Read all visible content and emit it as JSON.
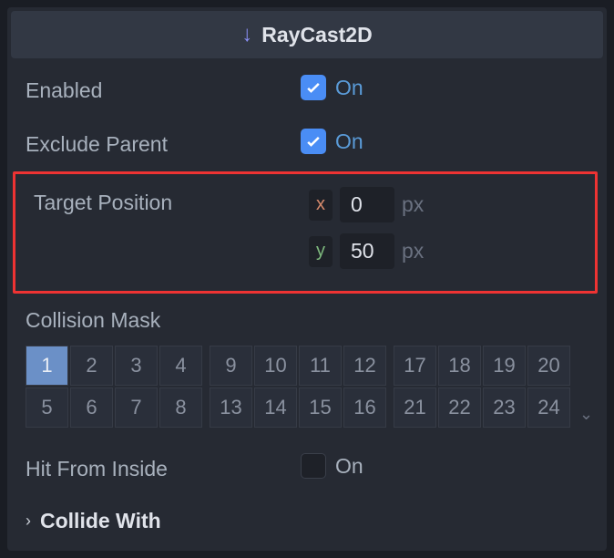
{
  "header": {
    "title": "RayCast2D"
  },
  "props": {
    "enabled": {
      "label": "Enabled",
      "state": "On"
    },
    "exclude_parent": {
      "label": "Exclude Parent",
      "state": "On"
    },
    "target_position": {
      "label": "Target Position",
      "x_label": "x",
      "x_value": "0",
      "y_label": "y",
      "y_value": "50",
      "unit": "px"
    },
    "collision_mask": {
      "label": "Collision Mask",
      "groups": [
        [
          {
            "n": "1",
            "active": true
          },
          {
            "n": "2",
            "active": false
          },
          {
            "n": "3",
            "active": false
          },
          {
            "n": "4",
            "active": false
          },
          {
            "n": "5",
            "active": false
          },
          {
            "n": "6",
            "active": false
          },
          {
            "n": "7",
            "active": false
          },
          {
            "n": "8",
            "active": false
          }
        ],
        [
          {
            "n": "9",
            "active": false
          },
          {
            "n": "10",
            "active": false
          },
          {
            "n": "11",
            "active": false
          },
          {
            "n": "12",
            "active": false
          },
          {
            "n": "13",
            "active": false
          },
          {
            "n": "14",
            "active": false
          },
          {
            "n": "15",
            "active": false
          },
          {
            "n": "16",
            "active": false
          }
        ],
        [
          {
            "n": "17",
            "active": false
          },
          {
            "n": "18",
            "active": false
          },
          {
            "n": "19",
            "active": false
          },
          {
            "n": "20",
            "active": false
          },
          {
            "n": "21",
            "active": false
          },
          {
            "n": "22",
            "active": false
          },
          {
            "n": "23",
            "active": false
          },
          {
            "n": "24",
            "active": false
          }
        ]
      ]
    },
    "hit_from_inside": {
      "label": "Hit From Inside",
      "state": "On"
    },
    "collide_with": {
      "label": "Collide With"
    }
  }
}
